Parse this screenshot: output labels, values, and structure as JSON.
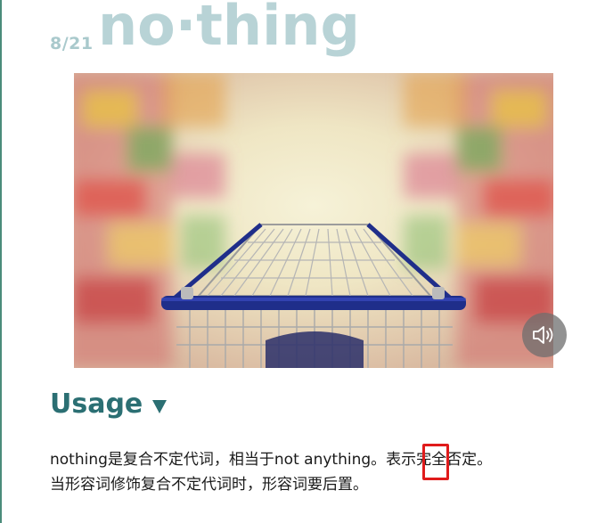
{
  "header": {
    "counter": "8/21",
    "word": "no·thing"
  },
  "image": {
    "description_icon": "shopping-cart-image"
  },
  "audio": {
    "icon": "speaker-icon"
  },
  "usage": {
    "label": "Usage",
    "caret_icon": "caret-down-icon"
  },
  "body": {
    "line1_a": "nothing是复合不定代词，相当于not anything",
    "line1_b": "。",
    "line1_c": "表示完全否定。",
    "line2": "当形容词修饰复合不定代词时，形容词要后置。"
  },
  "colors": {
    "accent": "#2b6f73",
    "title_light": "#b8d3d6",
    "highlight": "#e01b1b"
  }
}
